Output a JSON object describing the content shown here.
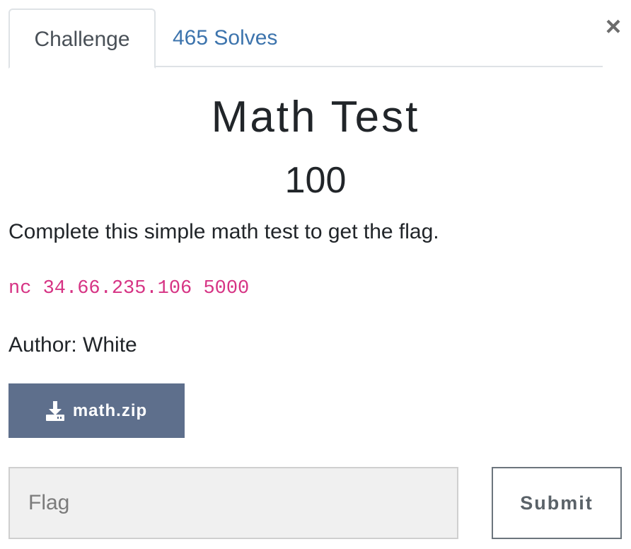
{
  "tabs": {
    "challenge_label": "Challenge",
    "solves_label": "465 Solves"
  },
  "close_glyph": "×",
  "challenge": {
    "name": "Math Test",
    "points": "100",
    "description": "Complete this simple math test to get the flag.",
    "connection": "nc 34.66.235.106 5000",
    "author": "Author: White"
  },
  "file": {
    "name": "math.zip",
    "icon": "download-icon"
  },
  "form": {
    "flag_placeholder": "Flag",
    "flag_value": "",
    "submit_label": "Submit"
  },
  "colors": {
    "link": "#3d74ad",
    "download_button": "#5e6f8c",
    "code": "#d63384"
  }
}
